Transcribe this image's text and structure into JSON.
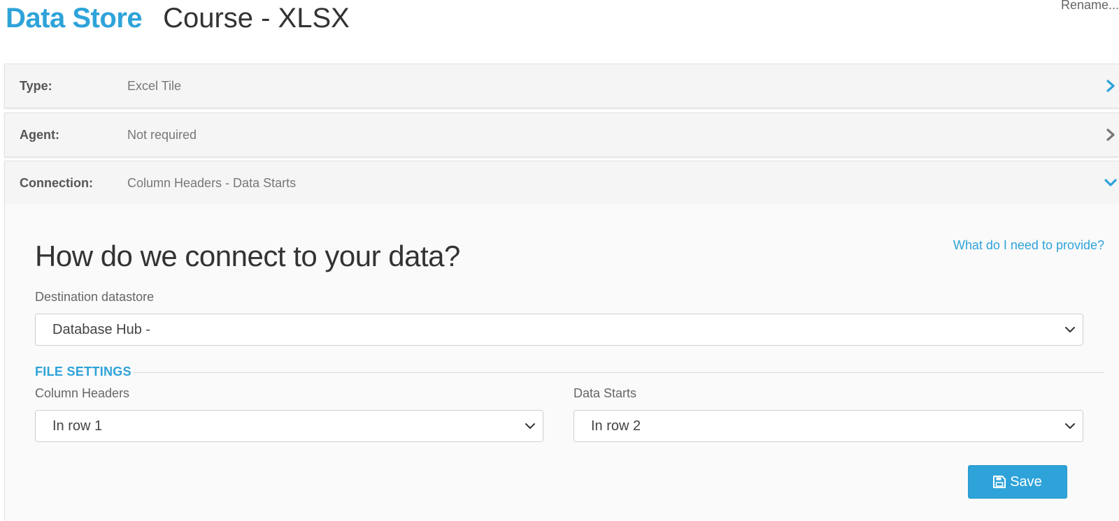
{
  "header": {
    "brand": "Data Store",
    "title": "Course - XLSX",
    "rename_label": "Rename..."
  },
  "summary_rows": [
    {
      "label": "Type:",
      "value": "Excel Tile",
      "chevron": "chevron-right-icon",
      "chevron_color": "#2ea3d9"
    },
    {
      "label": "Agent:",
      "value": "Not required",
      "chevron": "chevron-right-icon",
      "chevron_color": "#777777"
    },
    {
      "label": "Connection:",
      "value": "Column Headers - Data Starts",
      "chevron": "chevron-down-icon",
      "chevron_color": "#2ea3d9"
    }
  ],
  "connection_panel": {
    "help_link": "What do I need to provide?",
    "heading": "How do we connect to your data?",
    "destination": {
      "label": "Destination datastore",
      "selected": "Database Hub -"
    },
    "file_settings": {
      "title": "FILE SETTINGS",
      "column_headers": {
        "label": "Column Headers",
        "selected": "In row 1"
      },
      "data_starts": {
        "label": "Data Starts",
        "selected": "In row 2"
      }
    },
    "save_label": "Save"
  },
  "colors": {
    "accent": "#2ea3d9",
    "row_background": "#f5f5f5",
    "panel_background": "#fafafa"
  }
}
